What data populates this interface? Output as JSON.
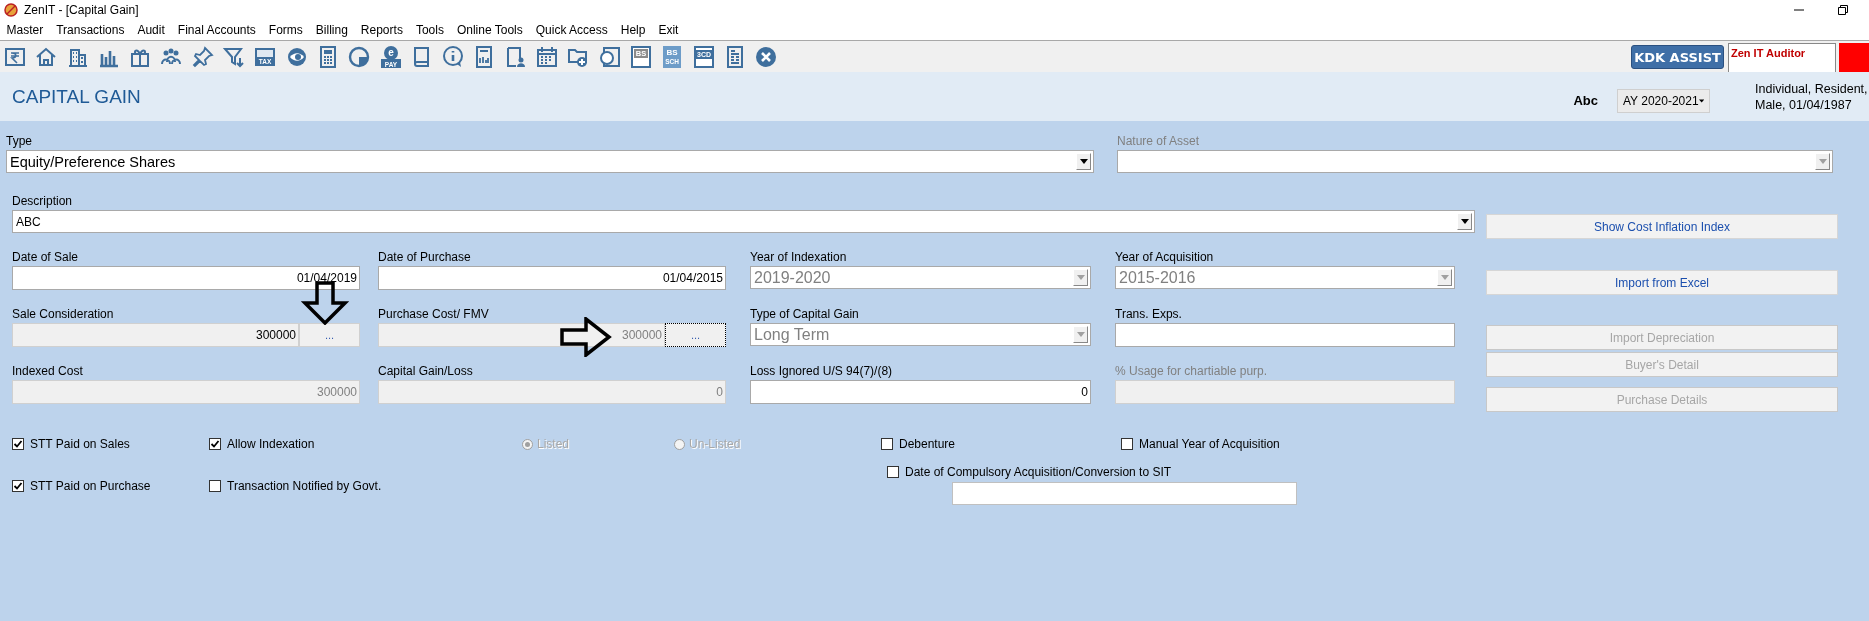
{
  "window": {
    "title": "ZenIT - [Capital Gain]"
  },
  "menu": [
    {
      "label": "Master"
    },
    {
      "label": "Transactions"
    },
    {
      "label": "Audit"
    },
    {
      "label": "Final Accounts"
    },
    {
      "label": "Forms"
    },
    {
      "label": "Billing"
    },
    {
      "label": "Reports"
    },
    {
      "label": "Tools"
    },
    {
      "label": "Online Tools"
    },
    {
      "label": "Quick Access"
    },
    {
      "label": "Help"
    },
    {
      "label": "Exit"
    }
  ],
  "toolbar": [
    {
      "kind": "rupee"
    },
    {
      "kind": "home"
    },
    {
      "kind": "building"
    },
    {
      "kind": "barchart"
    },
    {
      "kind": "gift"
    },
    {
      "kind": "people"
    },
    {
      "kind": "pin"
    },
    {
      "kind": "filter"
    },
    {
      "kind": "tax",
      "labels": [
        "TAX"
      ]
    },
    {
      "kind": "eye"
    },
    {
      "kind": "calculator"
    },
    {
      "kind": "pie"
    },
    {
      "kind": "epay",
      "labels": [
        "e",
        "PAY"
      ]
    },
    {
      "kind": "book"
    },
    {
      "kind": "info"
    },
    {
      "kind": "report"
    },
    {
      "kind": "userdoc"
    },
    {
      "kind": "calendar"
    },
    {
      "kind": "folderadd"
    },
    {
      "kind": "copy"
    },
    {
      "kind": "bs",
      "labels": [
        "BS"
      ]
    },
    {
      "kind": "bssch",
      "labels": [
        "BS",
        "SCH"
      ]
    },
    {
      "kind": "cd",
      "labels": [
        "3CD"
      ]
    },
    {
      "kind": "formlist"
    },
    {
      "kind": "close"
    }
  ],
  "assist_button": {
    "label": "KDK ASSIST"
  },
  "auditor_panel": {
    "label": "Zen IT Auditor"
  },
  "header": {
    "title": "CAPITAL GAIN",
    "client": "Abc",
    "assessment_year": "AY 2020-2021",
    "assessee": [
      "Individual, Resident,",
      "Male, 01/04/1987"
    ]
  },
  "type": {
    "label": "Type",
    "value": "Equity/Preference Shares",
    "disabled": false
  },
  "nature_of_asset": {
    "label": "Nature of Asset",
    "label_disabled": true,
    "disabled": true
  },
  "description": {
    "label": "Description",
    "value": "ABC",
    "disabled": false
  },
  "field_rows": [
    [
      {
        "kind": "text",
        "label": "Date of Sale",
        "value": "01/04/2019",
        "readonly": false,
        "disabled": false
      },
      {
        "kind": "text",
        "label": "Date of Purchase",
        "value": "01/04/2015",
        "readonly": false,
        "disabled": false
      },
      {
        "kind": "combo",
        "label": "Year of Indexation",
        "value": "2019-2020",
        "disabled": true
      },
      {
        "kind": "combo",
        "label": "Year of Acquisition",
        "value": "2015-2016",
        "disabled": true
      }
    ],
    [
      {
        "kind": "text-button",
        "label": "Sale Consideration",
        "value": "300000",
        "readonly": true,
        "disabled": false,
        "button": {
          "label": "...",
          "focused": false
        }
      },
      {
        "kind": "text-button",
        "label": "Purchase Cost/ FMV",
        "value": "300000",
        "readonly": true,
        "disabled": true,
        "button": {
          "label": "...",
          "focused": true
        }
      },
      {
        "kind": "combo",
        "label": "Type of Capital Gain",
        "value": "Long Term",
        "disabled": true
      },
      {
        "kind": "text",
        "label": "Trans. Exps.",
        "readonly": false
      }
    ],
    [
      {
        "kind": "text",
        "label": "Indexed Cost",
        "value": "300000",
        "readonly": true,
        "disabled": true
      },
      {
        "kind": "text",
        "label": "Capital Gain/Loss",
        "value": "0",
        "readonly": true,
        "disabled": true
      },
      {
        "kind": "text",
        "label": "Loss Ignored U/S 94(7)/(8)",
        "value": "0",
        "readonly": false,
        "disabled": false
      },
      {
        "kind": "text",
        "label": "% Usage for chartiable  purp.",
        "label_disabled": true,
        "readonly": true
      }
    ]
  ],
  "side_buttons": [
    {
      "label": "Show Cost Inflation Index",
      "disabled": false
    },
    {
      "label": "Import from Excel",
      "disabled": false
    },
    {
      "label": "Import Depreciation",
      "disabled": true
    },
    {
      "label": "Buyer's Detail",
      "disabled": true
    },
    {
      "label": "Purchase Details",
      "disabled": true
    }
  ],
  "options": [
    [
      {
        "kind": "checkbox",
        "label": "STT Paid on Sales",
        "checked": true
      },
      {
        "kind": "checkbox",
        "label": "STT Paid on Purchase",
        "checked": true
      }
    ],
    [
      {
        "kind": "checkbox",
        "label": "Allow Indexation",
        "checked": true
      },
      {
        "kind": "checkbox",
        "label": "Transaction Notified by Govt.",
        "checked": false
      }
    ],
    [
      {
        "kind": "radio",
        "label": "Listed",
        "selected": true,
        "disabled": true
      }
    ],
    [
      {
        "kind": "radio",
        "label": "Un-Listed",
        "selected": false,
        "disabled": true
      }
    ],
    [
      {
        "kind": "checkbox",
        "label": "Debenture",
        "checked": false
      },
      {
        "kind": "checkbox",
        "label": "Date of Compulsory Acquisition/Conversion to SIT",
        "checked": false
      },
      {
        "kind": "field"
      }
    ],
    [
      {
        "kind": "checkbox",
        "label": "Manual Year of Acquisition",
        "checked": false
      }
    ]
  ]
}
